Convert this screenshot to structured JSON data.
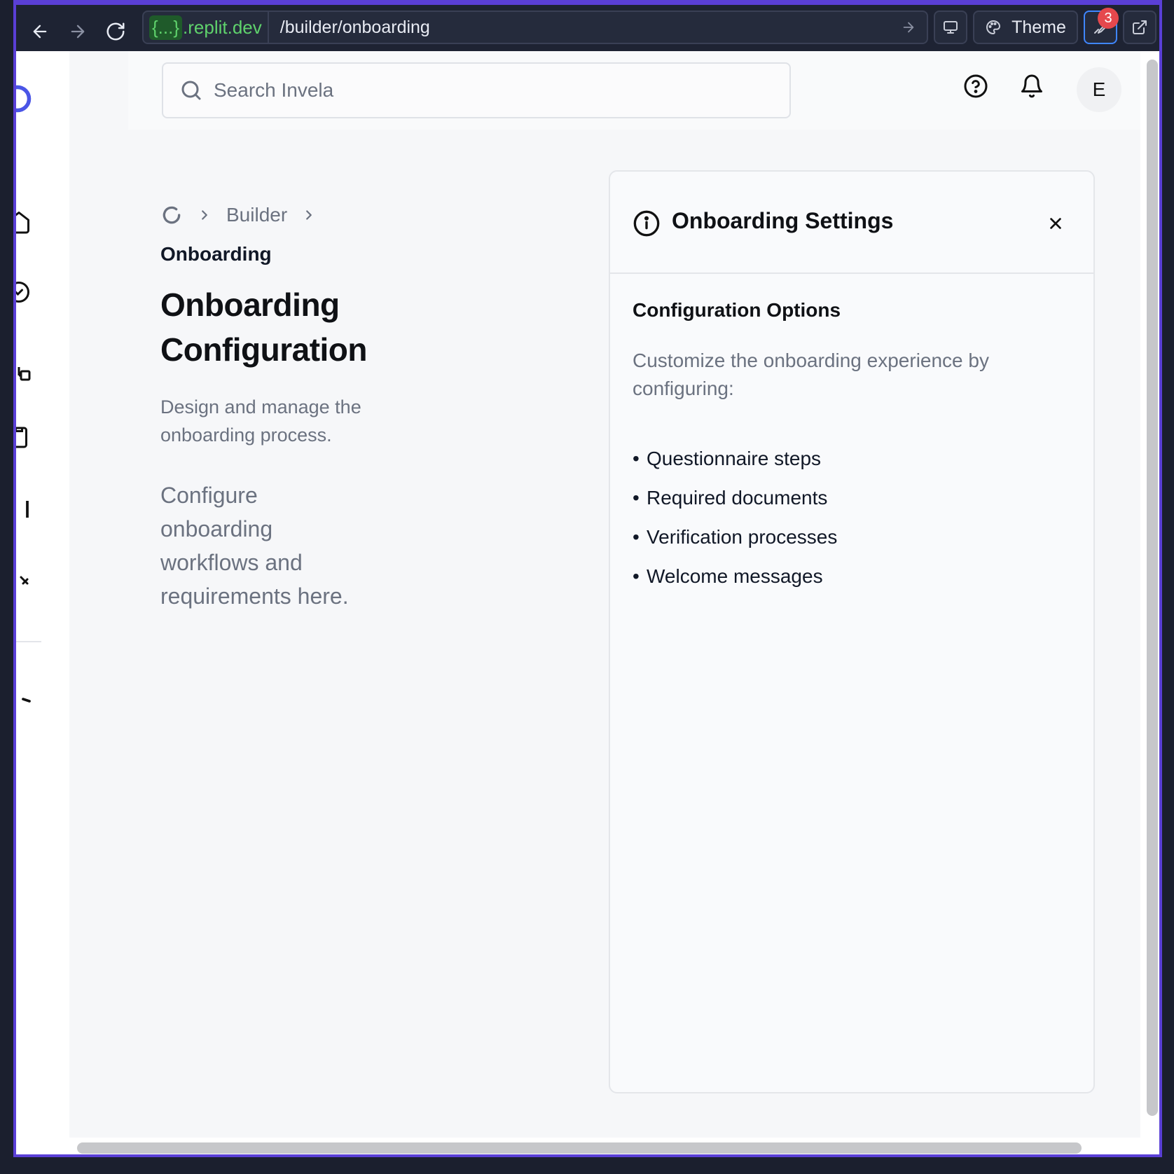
{
  "browser": {
    "back_icon": "arrow-left-icon",
    "forward_icon": "arrow-right-icon",
    "reload_icon": "reload-icon",
    "url_domain_tag": "{...}",
    "url_domain_rest": ".replit.dev",
    "url_path": "/builder/onboarding",
    "theme_label": "Theme",
    "devtools_badge": "3"
  },
  "header": {
    "search_placeholder": "Search Invela",
    "avatar_initial": "E"
  },
  "breadcrumb": {
    "items": [
      "Builder"
    ],
    "current": "Onboarding"
  },
  "main": {
    "title": "Onboarding Configuration",
    "subtitle": "Design and manage the onboarding process.",
    "description": "Configure onboarding workflows and requirements here."
  },
  "panel": {
    "title": "Onboarding Settings",
    "section_title": "Configuration Options",
    "intro": "Customize the onboarding experience by configuring:",
    "items": [
      "Questionnaire steps",
      "Required documents",
      "Verification processes",
      "Welcome messages"
    ]
  },
  "colors": {
    "frame": "#5a3fd6",
    "domain": "#5fd26c",
    "badge": "#e5484d",
    "focus": "#3f86ff",
    "text_muted": "#6b7280"
  }
}
